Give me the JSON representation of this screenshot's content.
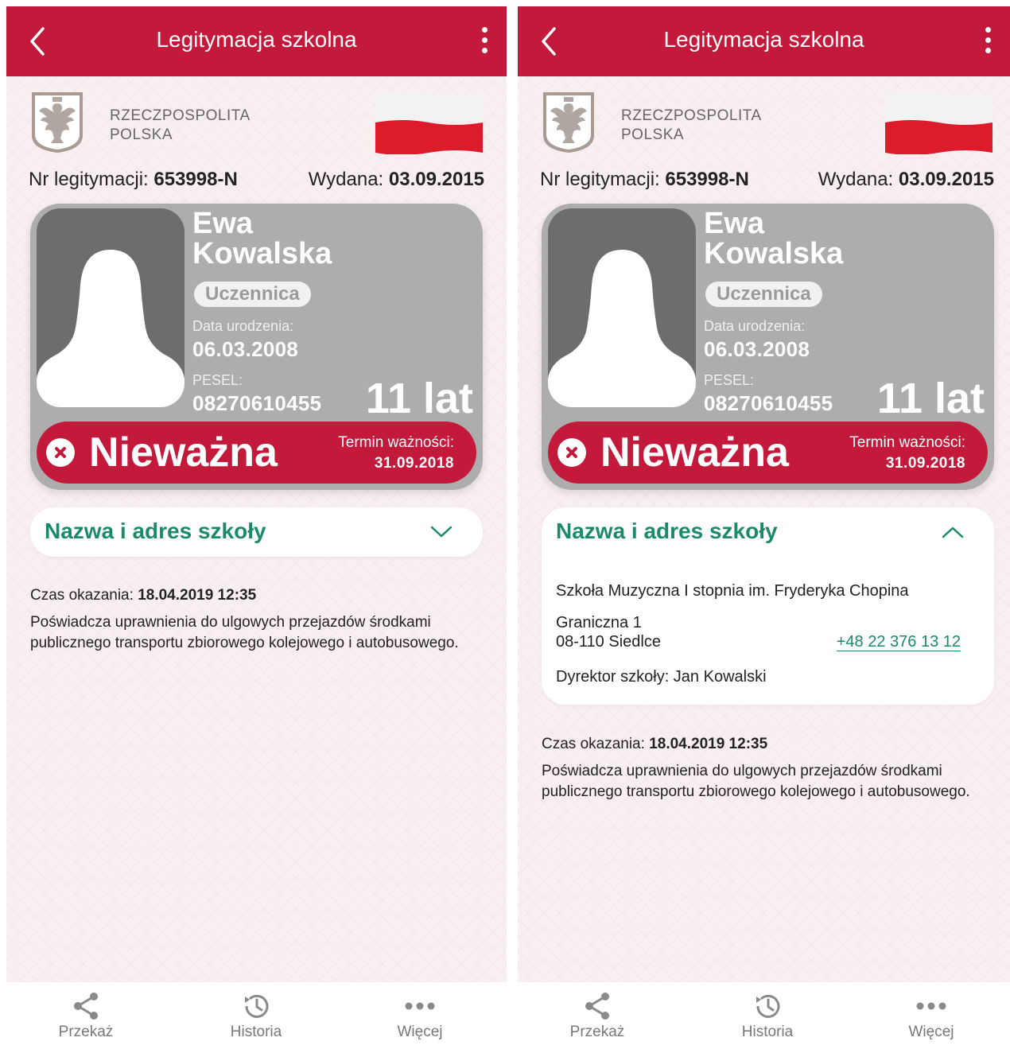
{
  "screens": [
    {
      "header": {
        "title": "Legitymacja szkolna"
      },
      "country": {
        "line1": "RZECZPOSPOLITA",
        "line2": "POLSKA"
      },
      "id_label": "Nr legitymacji:",
      "id_value": "653998-N",
      "issued_label": "Wydana:",
      "issued_value": "03.09.2015",
      "card": {
        "first_name": "Ewa",
        "last_name": "Kowalska",
        "role": "Uczennica",
        "dob_label": "Data urodzenia:",
        "dob_value": "06.03.2008",
        "pesel_label": "PESEL:",
        "pesel_value": "08270610455",
        "age": "11 lat",
        "status": "Nieważna",
        "expiry_label": "Termin ważności:",
        "expiry_value": "31.09.2018"
      },
      "school": {
        "title": "Nazwa i adres szkoły",
        "expanded": false
      },
      "notice": {
        "time_label": "Czas okazania:",
        "time_value": "18.04.2019 12:35",
        "text": "Poświadcza uprawnienia do ulgowych przejazdów środkami publicznego transportu zbiorowego kolejowego i autobusowego."
      },
      "nav": [
        {
          "label": "Przekaż",
          "icon": "share-icon"
        },
        {
          "label": "Historia",
          "icon": "history-icon"
        },
        {
          "label": "Więcej",
          "icon": "more-icon"
        }
      ]
    },
    {
      "header": {
        "title": "Legitymacja szkolna"
      },
      "country": {
        "line1": "RZECZPOSPOLITA",
        "line2": "POLSKA"
      },
      "id_label": "Nr legitymacji:",
      "id_value": "653998-N",
      "issued_label": "Wydana:",
      "issued_value": "03.09.2015",
      "card": {
        "first_name": "Ewa",
        "last_name": "Kowalska",
        "role": "Uczennica",
        "dob_label": "Data urodzenia:",
        "dob_value": "06.03.2008",
        "pesel_label": "PESEL:",
        "pesel_value": "08270610455",
        "age": "11 lat",
        "status": "Nieważna",
        "expiry_label": "Termin ważności:",
        "expiry_value": "31.09.2018"
      },
      "school": {
        "title": "Nazwa i adres szkoły",
        "expanded": true,
        "name": "Szkoła Muzyczna I stopnia im. Fryderyka Chopina",
        "street": "Graniczna 1",
        "city": "08-110 Siedlce",
        "phone": "+48 22 376 13 12",
        "director": "Dyrektor szkoły: Jan Kowalski"
      },
      "notice": {
        "time_label": "Czas okazania:",
        "time_value": "18.04.2019 12:35",
        "text": "Poświadcza uprawnienia do ulgowych przejazdów środkami publicznego transportu zbiorowego kolejowego i autobusowego."
      },
      "nav": [
        {
          "label": "Przekaż",
          "icon": "share-icon"
        },
        {
          "label": "Historia",
          "icon": "history-icon"
        },
        {
          "label": "Więcej",
          "icon": "more-icon"
        }
      ]
    }
  ],
  "colors": {
    "brand_red": "#c3193b",
    "accent_green": "#1a8a6a",
    "card_gray": "#adadad"
  }
}
